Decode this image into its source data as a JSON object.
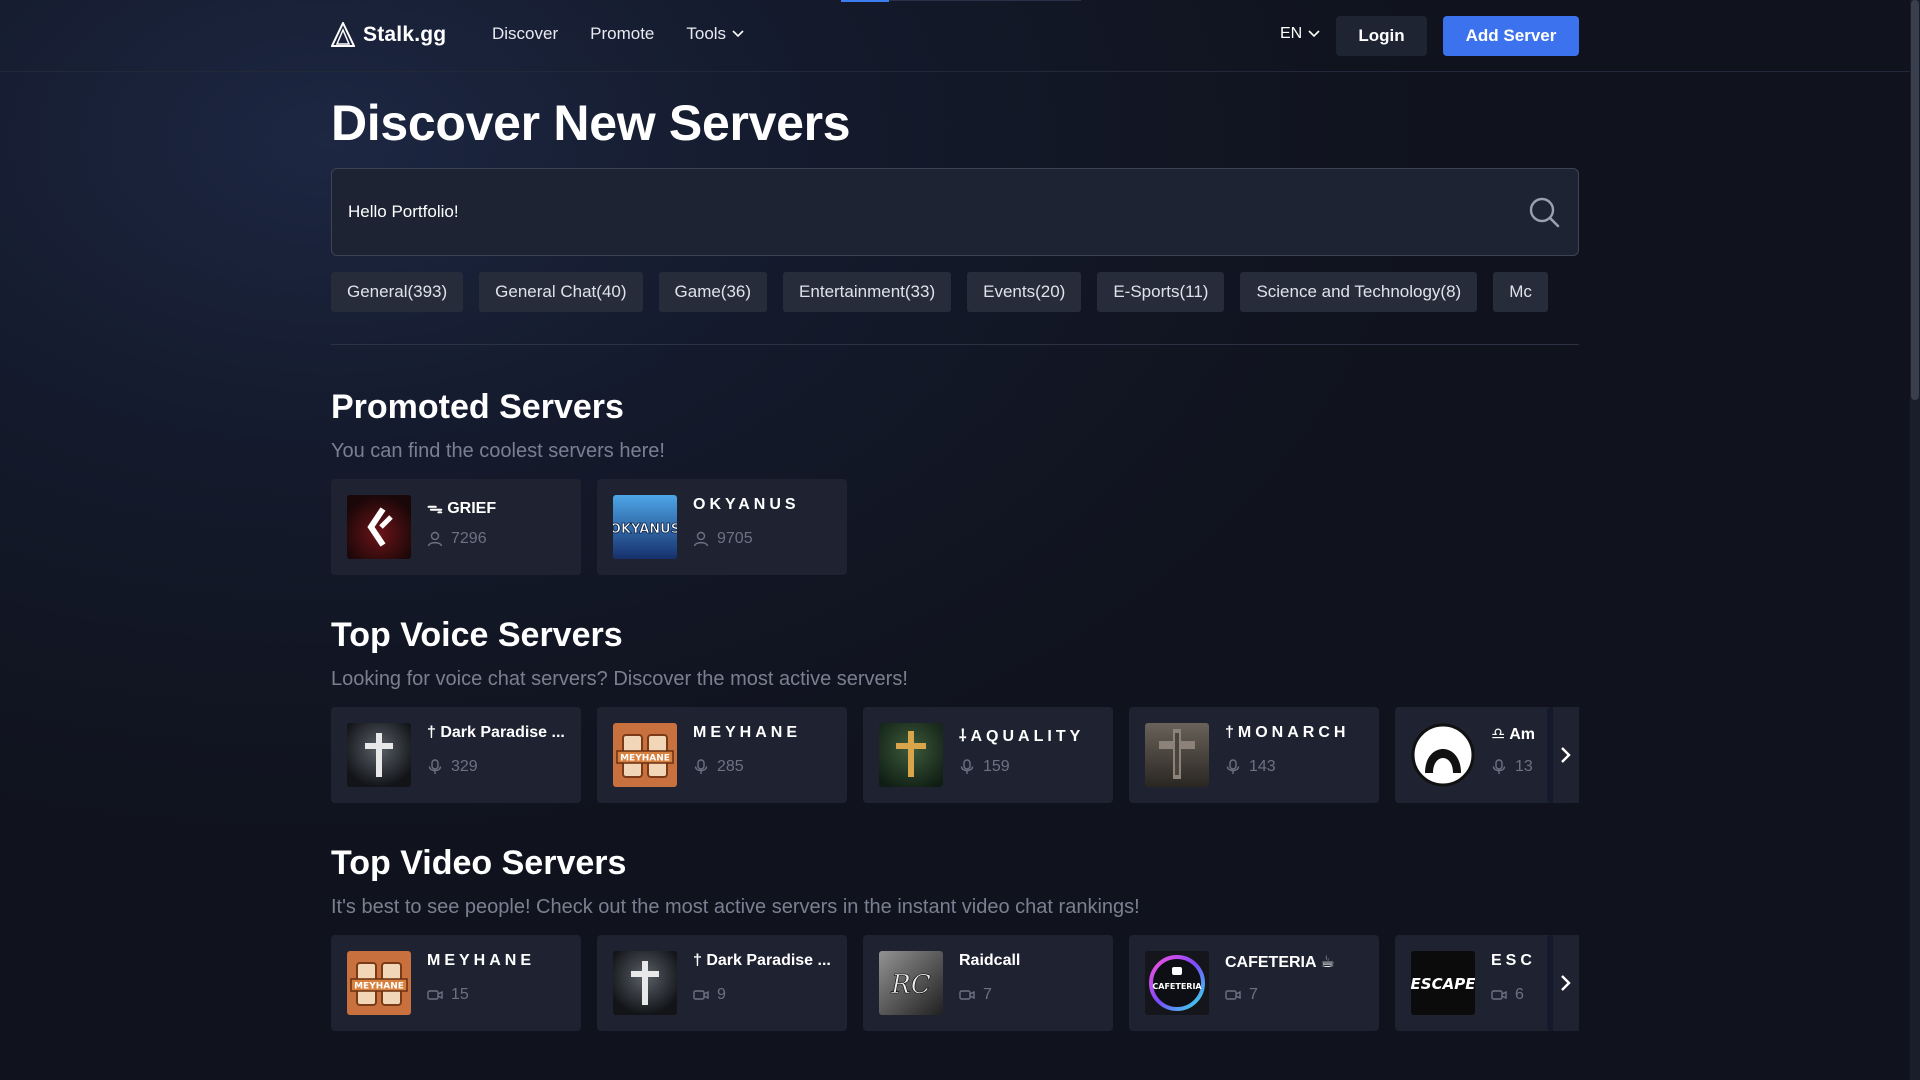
{
  "nav": {
    "logo": "Stalk.gg",
    "links": [
      "Discover",
      "Promote",
      "Tools"
    ],
    "language": "EN",
    "login": "Login",
    "add_server": "Add Server"
  },
  "title": "Discover New Servers",
  "search": {
    "value": "Hello Portfolio!"
  },
  "categories": [
    "General(393)",
    "General Chat(40)",
    "Game(36)",
    "Entertainment(33)",
    "Events(20)",
    "E-Sports(11)",
    "Science and Technology(8)",
    "Mc"
  ],
  "promoted": {
    "title": "Promoted Servers",
    "subtitle": "You can find the coolest servers here!",
    "servers": [
      {
        "name": "ᯓ GRIEF",
        "count": "7296",
        "icon": "grief-logo"
      },
      {
        "name": "OKYANUS",
        "count": "9705",
        "icon": "okyanus-logo"
      }
    ]
  },
  "voice": {
    "title": "Top Voice Servers",
    "subtitle": "Looking for voice chat servers? Discover the most active servers!",
    "servers": [
      {
        "name": "† Dark Paradise ...",
        "count": "329",
        "icon": "cross-logo"
      },
      {
        "name": "MEYHANE",
        "count": "285",
        "icon": "meyhane-logo"
      },
      {
        "name": "⸸AQUALITY",
        "count": "159",
        "icon": "golden-cross-logo"
      },
      {
        "name": "†MONARCH",
        "count": "143",
        "icon": "monarch-logo"
      },
      {
        "name": "♎ Am",
        "count": "13",
        "icon": "circle-face-logo"
      }
    ]
  },
  "video": {
    "title": "Top Video Servers",
    "subtitle": "It's best to see people! Check out the most active servers in the instant video chat rankings!",
    "servers": [
      {
        "name": "MEYHANE",
        "count": "15",
        "icon": "meyhane-logo"
      },
      {
        "name": "† Dark Paradise ...",
        "count": "9",
        "icon": "cross-logo"
      },
      {
        "name": "Raidcall",
        "count": "7",
        "icon": "raidcall-logo"
      },
      {
        "name": "CAFETERIA ☕",
        "count": "7",
        "icon": "cafeteria-logo"
      },
      {
        "name": "ESC",
        "count": "6",
        "icon": "escape-logo",
        "icon_text": "ESCAPE"
      }
    ]
  },
  "colors": {
    "accent": "#3d72ee",
    "card_bg": "#1f2331",
    "muted": "#7a8091"
  }
}
